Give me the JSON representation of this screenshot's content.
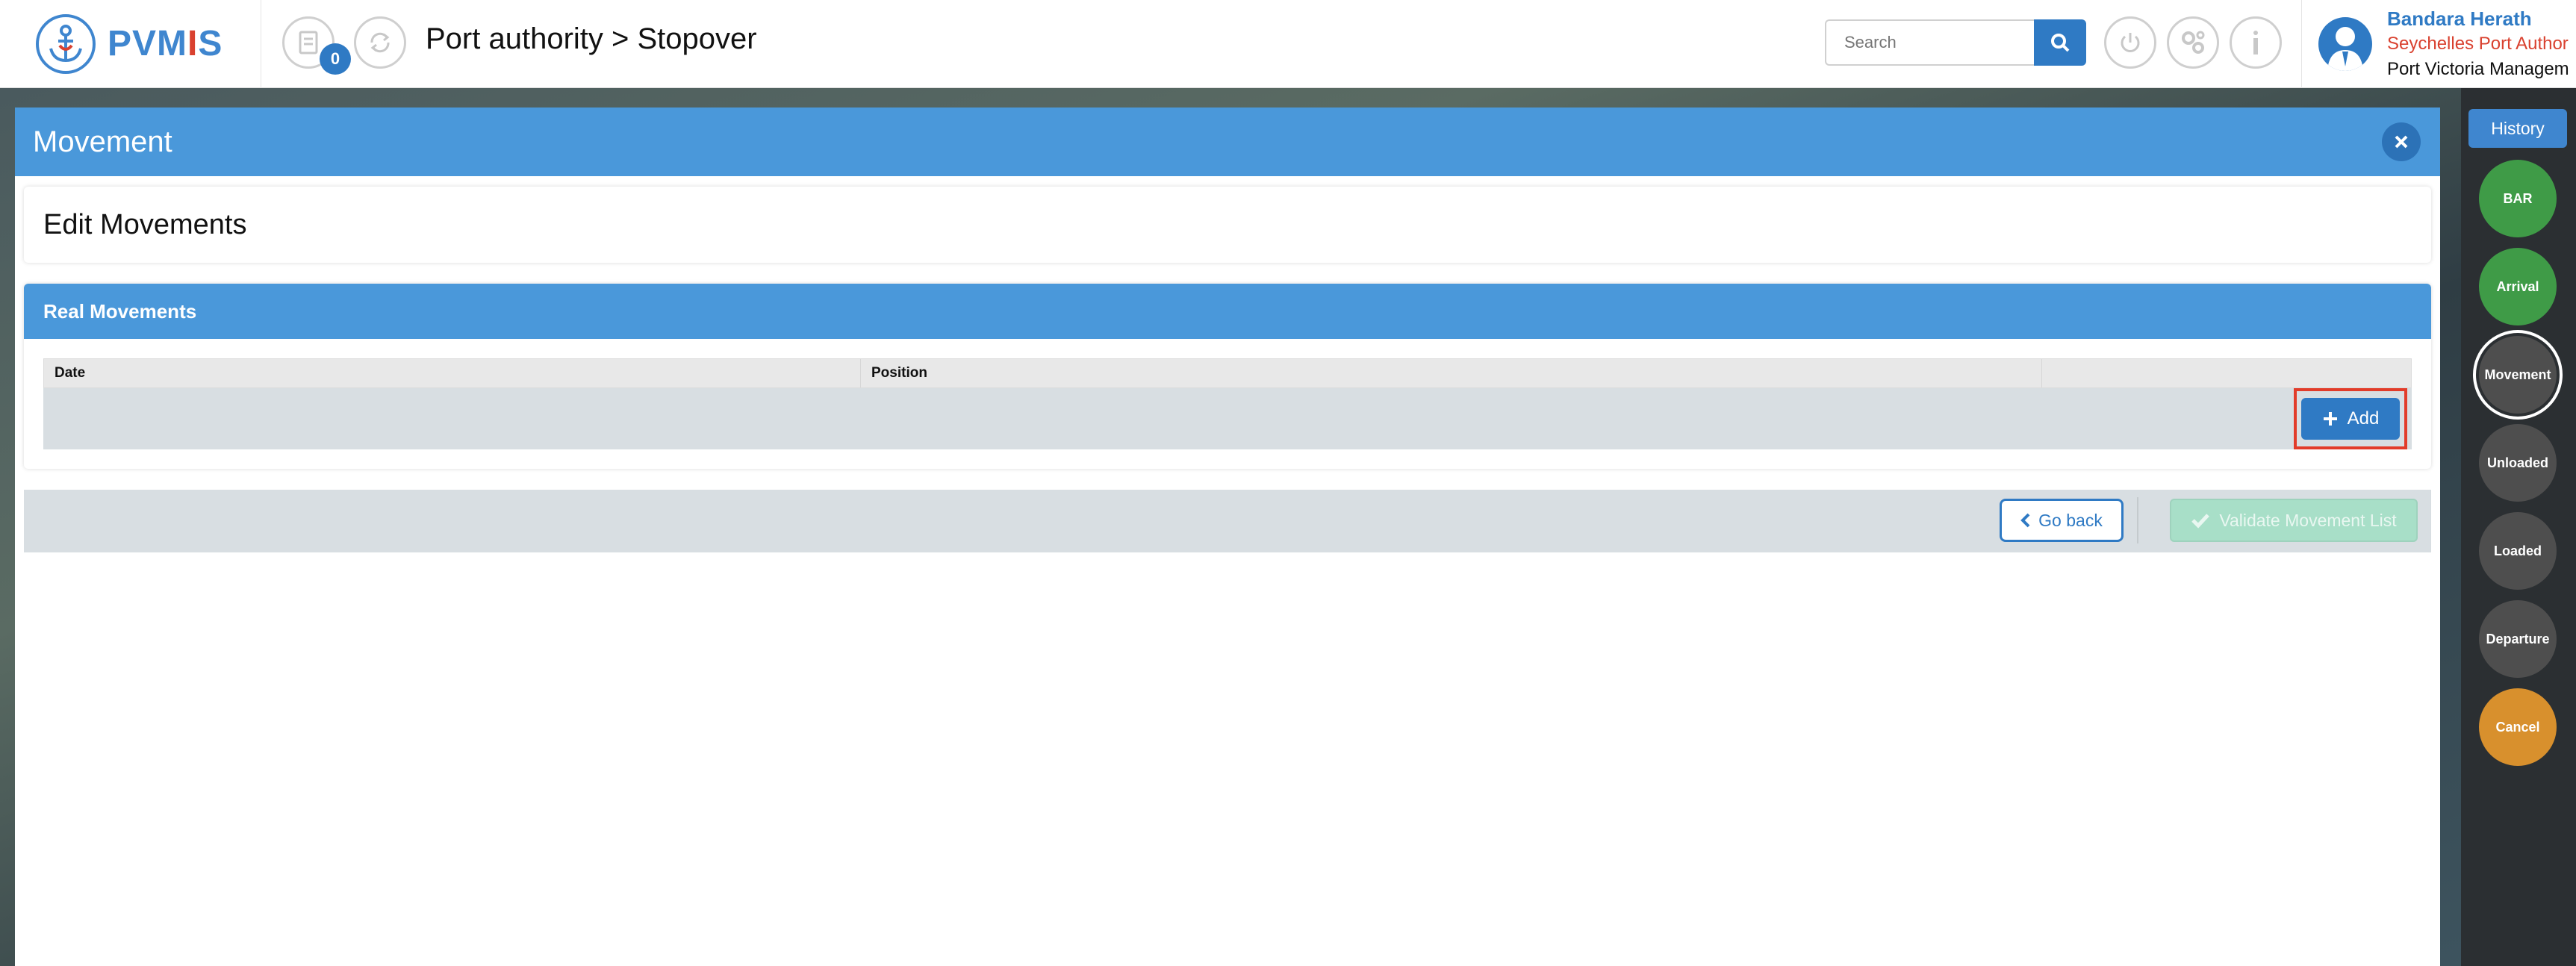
{
  "header": {
    "logo_text_main": "PVM",
    "logo_text_accent": "I",
    "logo_text_end": "S",
    "notification_count": "0",
    "breadcrumb": "Port authority > Stopover",
    "search_placeholder": "Search"
  },
  "user": {
    "name": "Bandara Herath",
    "organization": "Seychelles Port Author",
    "department": "Port Victoria Managem"
  },
  "modal": {
    "title": "Movement",
    "edit_title": "Edit Movements",
    "section_title": "Real Movements",
    "columns": [
      "Date",
      "Position",
      ""
    ],
    "add_label": "Add",
    "go_back_label": "Go back",
    "validate_label": "Validate Movement List"
  },
  "sidebar": {
    "history_label": "History",
    "steps": [
      {
        "label": "BAR",
        "state": "done"
      },
      {
        "label": "Arrival",
        "state": "done"
      },
      {
        "label": "Movement",
        "state": "active"
      },
      {
        "label": "Unloaded",
        "state": "pending"
      },
      {
        "label": "Loaded",
        "state": "pending"
      },
      {
        "label": "Departure",
        "state": "pending"
      },
      {
        "label": "Cancel",
        "state": "cancel"
      }
    ]
  },
  "colors": {
    "primary": "#4a98da",
    "brand_blue": "#2f7ac4",
    "brand_red": "#d9412f",
    "step_done": "#3f9b47",
    "step_pending": "#4e4e4e",
    "step_cancel": "#d8902d",
    "highlight": "#e23c2a"
  }
}
